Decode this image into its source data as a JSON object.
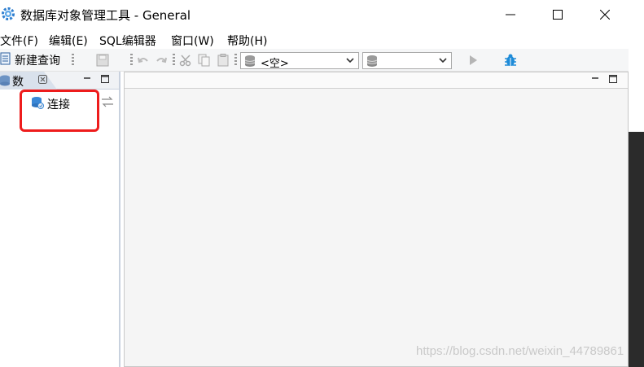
{
  "window": {
    "title": "数据库对象管理工具 - General"
  },
  "menu": [
    {
      "label": "文件(F)"
    },
    {
      "label": "编辑(E)"
    },
    {
      "label": "SQL编辑器"
    },
    {
      "label": "窗口(W)"
    },
    {
      "label": "帮助(H)"
    }
  ],
  "toolbar": {
    "new_query_label": "新建查询",
    "connection_combo_value": "<空>",
    "database_combo_value": ""
  },
  "left_panel": {
    "tab_label": "数",
    "tree_items": [
      {
        "label": "连接"
      }
    ]
  },
  "watermark": "https://blog.csdn.net/weixin_44789861",
  "colors": {
    "highlight": "#ee1c1c",
    "accent": "#1e8bd8"
  }
}
